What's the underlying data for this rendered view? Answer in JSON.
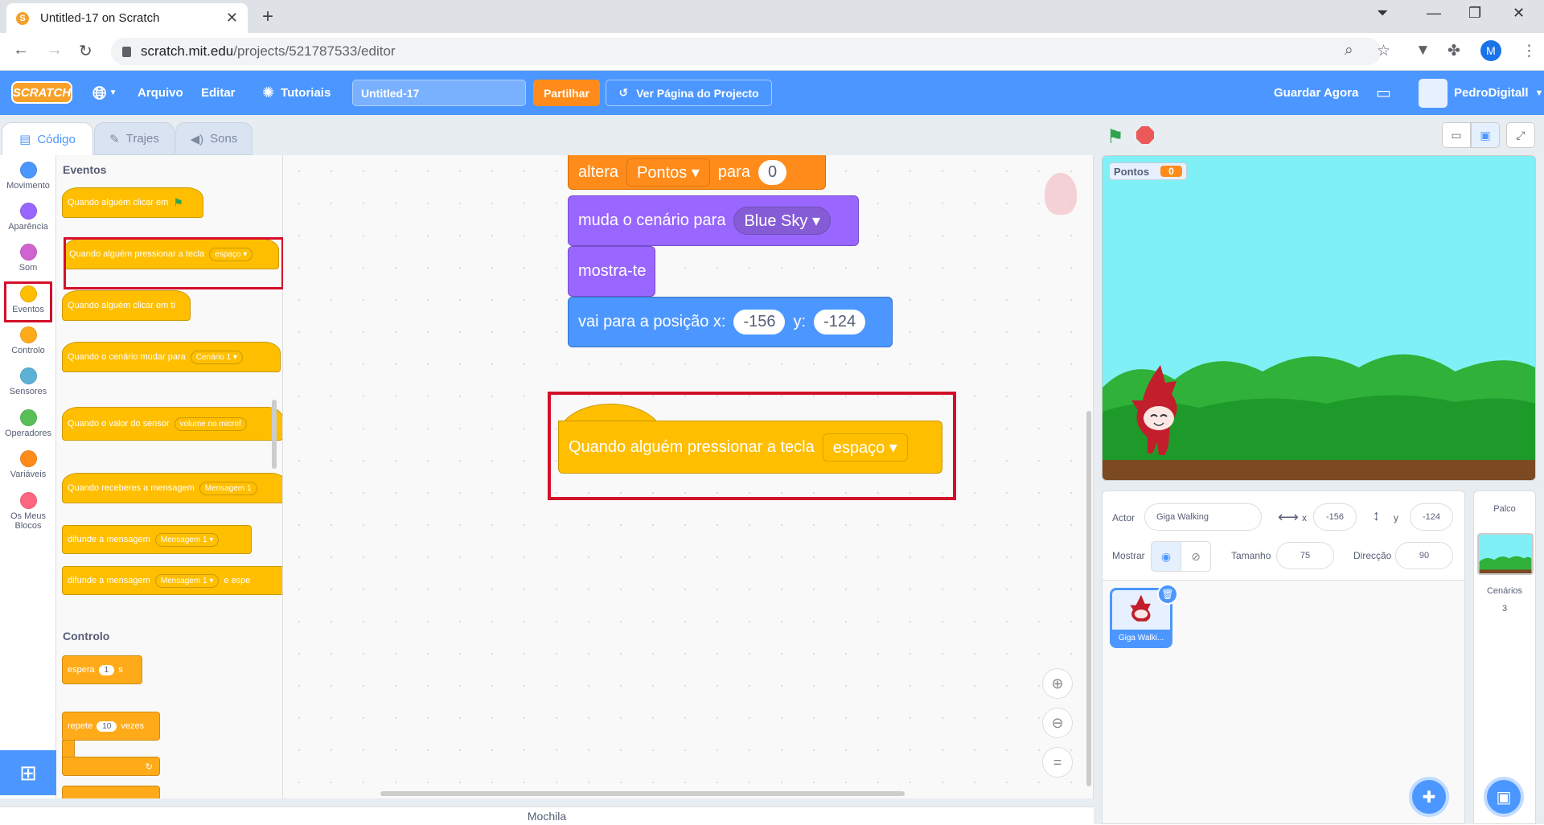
{
  "browser": {
    "tab_title": "Untitled-17 on Scratch",
    "favicon_letter": "S",
    "url_host": "scratch.mit.edu",
    "url_path": "/projects/521787533/editor",
    "profile_initial": "M"
  },
  "menubar": {
    "logo": "SCRATCH",
    "file": "Arquivo",
    "edit": "Editar",
    "tutorials": "Tutoriais",
    "project_title": "Untitled-17",
    "share": "Partilhar",
    "see_project": "Ver Página do Projecto",
    "save_now": "Guardar Agora",
    "username": "PedroDigitall"
  },
  "editor_tabs": {
    "code": "Código",
    "costumes": "Trajes",
    "sounds": "Sons"
  },
  "categories": [
    {
      "label": "Movimento",
      "color": "#4c97ff"
    },
    {
      "label": "Aparência",
      "color": "#9966ff"
    },
    {
      "label": "Som",
      "color": "#cf63cf"
    },
    {
      "label": "Eventos",
      "color": "#ffbf00"
    },
    {
      "label": "Controlo",
      "color": "#ffab19"
    },
    {
      "label": "Sensores",
      "color": "#5cb1d6"
    },
    {
      "label": "Operadores",
      "color": "#59c059"
    },
    {
      "label": "Variáveis",
      "color": "#ff8c1a"
    },
    {
      "label": "Os Meus Blocos",
      "color": "#ff6680"
    }
  ],
  "palette": {
    "events_heading": "Eventos",
    "when_flag": "Quando alguém clicar em",
    "when_key": "Quando alguém pressionar a tecla",
    "when_key_value": "espaço",
    "when_sprite_clicked": "Quando alguém clicar em ti",
    "when_backdrop": "Quando o cenário mudar para",
    "when_backdrop_value": "Cenário 1",
    "when_sensor": "Quando o valor do sensor",
    "when_sensor_value": "volume no microf",
    "when_receive": "Quando receberes a mensagem",
    "when_receive_value": "Mensagem 1",
    "broadcast": "difunde a mensagem",
    "broadcast_value": "Mensagem 1",
    "broadcast_wait": "difunde a mensagem",
    "broadcast_wait_value": "Mensagem 1",
    "broadcast_wait_suffix": "e espe",
    "control_heading": "Controlo",
    "wait": "espera",
    "wait_value": "1",
    "wait_unit": "s",
    "repeat": "repete",
    "repeat_value": "10",
    "repeat_suffix": "vezes"
  },
  "script": {
    "set_var": "altera",
    "set_var_name": "Pontos",
    "set_var_to": "para",
    "set_var_value": "0",
    "switch_backdrop": "muda o cenário para",
    "switch_backdrop_value": "Blue Sky",
    "show": "mostra-te",
    "goto": "vai para a posição x:",
    "goto_x": "-156",
    "goto_y_label": "y:",
    "goto_y": "-124",
    "hat_key": "Quando alguém pressionar a tecla",
    "hat_key_value": "espaço"
  },
  "backpack": "Mochila",
  "stage": {
    "monitor_label": "Pontos",
    "monitor_value": "0"
  },
  "sprite_info": {
    "sprite_label": "Actor",
    "sprite_name": "Giga Walking",
    "x_label": "x",
    "x_value": "-156",
    "y_label": "y",
    "y_value": "-124",
    "show_label": "Mostrar",
    "size_label": "Tamanho",
    "size_value": "75",
    "direction_label": "Direcção",
    "direction_value": "90"
  },
  "sprite_list": {
    "thumb_name": "Giga Walki..."
  },
  "stage_panel": {
    "title": "Palco",
    "backdrops_label": "Cenários",
    "backdrops_count": "3"
  }
}
